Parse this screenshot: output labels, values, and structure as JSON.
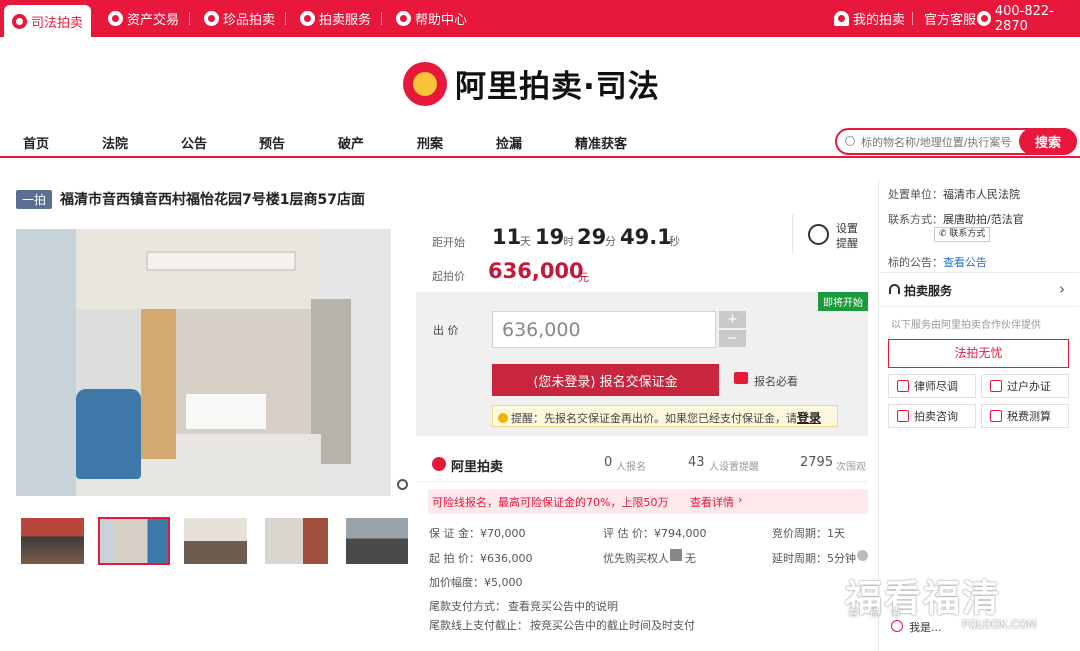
{
  "topbar": {
    "tabs": [
      {
        "label": "司法拍卖",
        "icon": "gavel-icon"
      },
      {
        "label": "资产交易",
        "icon": "asset-icon"
      },
      {
        "label": "珍品拍卖",
        "icon": "treasure-icon"
      },
      {
        "label": "拍卖服务",
        "icon": "heart-icon"
      },
      {
        "label": "帮助中心",
        "icon": "help-icon"
      }
    ],
    "my_auction": "我的拍卖",
    "official_service": "官方客服",
    "phone": "400-822-2870"
  },
  "logo": {
    "text": "阿里拍卖·司法"
  },
  "nav": {
    "items": [
      "首页",
      "法院",
      "公告",
      "预告",
      "破产",
      "刑案",
      "捡漏",
      "精准获客"
    ],
    "search_placeholder": "标的物名称/地理位置/执行案号",
    "search_button": "搜索"
  },
  "item": {
    "badge": "一拍",
    "title": "福清市音西镇音西村福怡花园7号楼1层商57店面"
  },
  "countdown": {
    "label": "距开始",
    "days": "11",
    "days_unit": "天",
    "hours": "19",
    "hours_unit": "时",
    "minutes": "29",
    "minutes_unit": "分",
    "seconds": "49.1",
    "seconds_unit": "秒",
    "reminder": "设置提醒"
  },
  "start_price": {
    "label": "起拍价",
    "value": "636,000",
    "unit": "元"
  },
  "bid": {
    "status_badge": "即将开始",
    "label": "出 价",
    "value": "636,000",
    "plus": "+",
    "minus": "−",
    "register_button": "(您未登录) 报名交保证金",
    "must_read": "报名必看",
    "tip_text": "提醒：先报名交保证金再出价。如果您已经支付保证金，请",
    "tip_login": "登录"
  },
  "stats": {
    "brand": "阿里拍卖",
    "registered_count": "0",
    "registered_label": "人报名",
    "reminder_count": "43",
    "reminder_label": "人设置提醒",
    "views_count": "2795",
    "views_label": "次围观"
  },
  "insurance": {
    "text": "可险线报名，最高可险保证金的70%，上限50万",
    "link": "查看详情"
  },
  "details": {
    "deposit": "保 证 金：¥70,000",
    "appraisal": "评 估 价：¥794,000",
    "cycle": "竞价周期：1天",
    "start_price": "起 拍 价：¥636,000",
    "priority": "优先购买权人",
    "priority_value": "无",
    "delay": "延时周期：5分钟",
    "increment": "加价幅度：¥5,000",
    "payment_label": "尾款支付方式：",
    "payment_value": "查看竞买公告中的说明",
    "deadline_label": "尾款线上支付截止：",
    "deadline_value": "按竞买公告中的截止时间及时支付"
  },
  "sidebar": {
    "unit_label": "处置单位：",
    "unit_value": "福清市人民法院",
    "contact_label": "联系方式：",
    "contact_value": "展唐助拍/范法官",
    "contact_button": "联系方式",
    "notice_label": "标的公告：",
    "notice_link": "查看公告",
    "service_title": "拍卖服务",
    "service_note": "以下服务由阿里拍卖合作伙伴提供",
    "main_service": "法拍无忧",
    "services": [
      "律师尽调",
      "过户办证",
      "拍卖咨询",
      "税费测算"
    ],
    "footer": "我是..."
  },
  "watermark": {
    "text": "福看福清",
    "sub_left": "看 福 清",
    "url": "FQLOOK.COM"
  },
  "colors": {
    "brand": "#e8173c",
    "price": "#c8163a",
    "green": "#1a9b3c"
  }
}
